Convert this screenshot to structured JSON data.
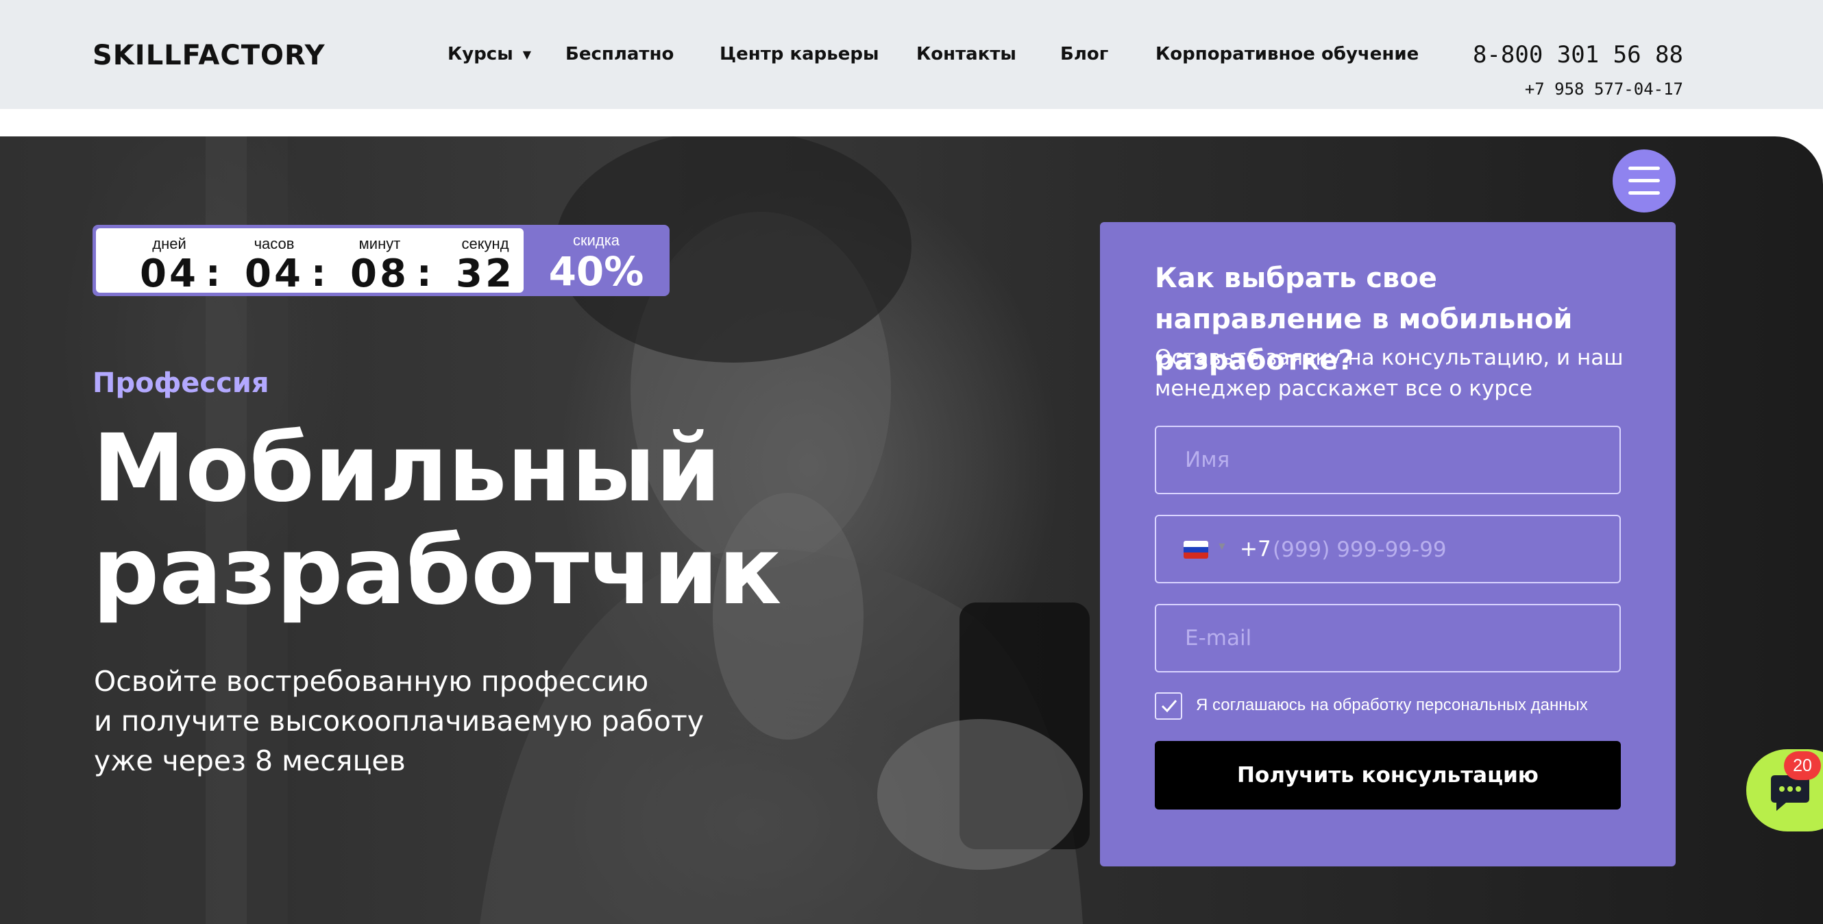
{
  "header": {
    "logo": "SKILLFACTORY",
    "nav": [
      {
        "label": "Курсы"
      },
      {
        "label": "Бесплатно"
      },
      {
        "label": "Центр карьеры"
      },
      {
        "label": "Контакты"
      },
      {
        "label": "Блог"
      },
      {
        "label": "Корпоративное обучение"
      }
    ],
    "phone_main": "8-800 301 56 88",
    "phone_sub": "+7 958 577-04-17"
  },
  "timer": {
    "days_label": "дней",
    "hours_label": "часов",
    "minutes_label": "минут",
    "seconds_label": "секунд",
    "days": "04",
    "hours": "04",
    "minutes": "08",
    "seconds": "32",
    "separator": ":",
    "discount_label": "скидка",
    "discount_value": "40%"
  },
  "hero": {
    "eyebrow": "Профессия",
    "title_line1": "Мобильный",
    "title_line2": "разработчик",
    "subtitle_line1": "Освойте востребованную профессию",
    "subtitle_line2": "и получите высокооплачиваемую работу",
    "subtitle_line3": "уже через 8 месяцев"
  },
  "form": {
    "title": "Как выбрать свое направление в мобильной разработке?",
    "description": "Оставьте заявку на консультацию, и наш менеджер расскажет все о курсе",
    "name_placeholder": "Имя",
    "phone_prefix": "+7",
    "phone_placeholder": "(999) 999-99-99",
    "email_placeholder": "E-mail",
    "consent": "Я соглашаюсь на обработку персональных данных",
    "consent_checked": true,
    "submit": "Получить консультацию"
  },
  "chat": {
    "badge": "20"
  },
  "colors": {
    "accent": "#7f73cf",
    "accent_light": "#b3a9ff",
    "chat_green": "#b8ee4a",
    "badge_red": "#f03a3a",
    "header_bg": "#e9ecef"
  },
  "icons": {
    "menu": "hamburger-icon",
    "chat": "chat-bubble-icon",
    "check": "checkmark-icon",
    "flag": "russia-flag-icon",
    "dropdown": "chevron-down-icon"
  }
}
